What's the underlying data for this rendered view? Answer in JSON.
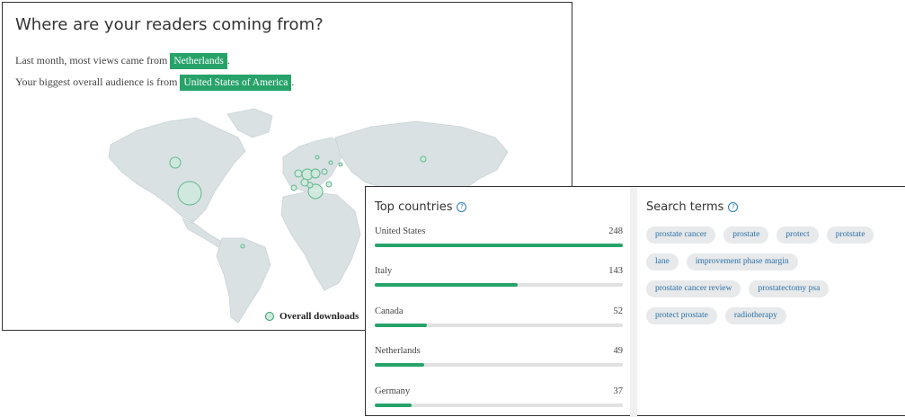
{
  "map_panel": {
    "title": "Where are your readers coming from?",
    "line1_prefix": "Last month, most views came from",
    "line1_highlight": "Netherlands",
    "line1_suffix": ".",
    "line2_prefix": "Your biggest overall audience is from",
    "line2_highlight": "United States of America",
    "line2_suffix": ".",
    "legend_label": "Overall downloads",
    "colors": {
      "highlight": "#27a36a",
      "land": "#d9e1e3",
      "bubble_fill": "#cfe9dd",
      "bubble_stroke": "#5fb88b"
    }
  },
  "top_countries": {
    "title": "Top countries",
    "items": [
      {
        "name": "United States",
        "count": "248",
        "fraction": 1.0
      },
      {
        "name": "Italy",
        "count": "143",
        "fraction": 0.577
      },
      {
        "name": "Canada",
        "count": "52",
        "fraction": 0.21
      },
      {
        "name": "Netherlands",
        "count": "49",
        "fraction": 0.198
      },
      {
        "name": "Germany",
        "count": "37",
        "fraction": 0.149
      }
    ]
  },
  "search_terms": {
    "title": "Search terms",
    "lines": [
      [
        "prostate cancer",
        "prostate",
        "protect",
        "protstate"
      ],
      [
        "lane",
        "improvement phase margin"
      ],
      [
        "prostate cancer review",
        "prostatectomy psa"
      ],
      [
        "protect prostate",
        "radiotherapy"
      ]
    ]
  }
}
